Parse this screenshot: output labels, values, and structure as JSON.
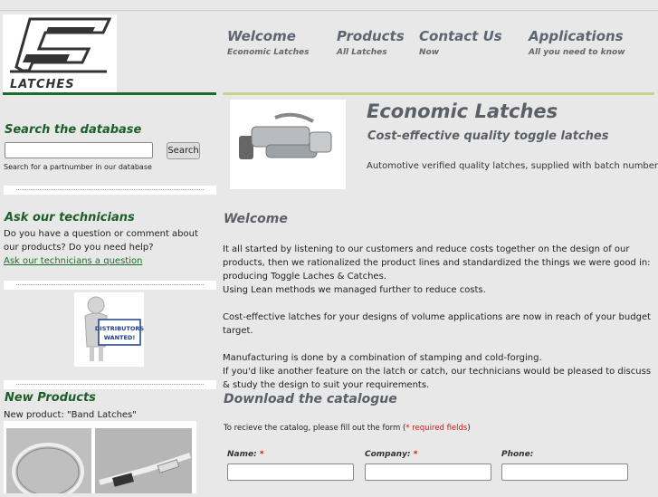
{
  "logo": {
    "word": "LATCHES"
  },
  "nav": [
    {
      "title": "Welcome",
      "sub": "Economic Latches"
    },
    {
      "title": "Products",
      "sub": "All Latches"
    },
    {
      "title": "Contact Us",
      "sub": "Now"
    },
    {
      "title": "Applications",
      "sub": "All you need to know"
    }
  ],
  "sidebar": {
    "search": {
      "heading": "Search the database",
      "button": "Search",
      "hint": "Search for a partnumber in our database"
    },
    "ask": {
      "heading": "Ask our technicians",
      "text": "Do you have a question or comment about our products? Do you need help?",
      "link": "Ask our technicians a question"
    },
    "distributors": {
      "line1": "DISTRIBUTORS",
      "line2": "WANTED!"
    },
    "new_products": {
      "heading": "New Products",
      "text": "New product: \"Band Latches\""
    }
  },
  "main": {
    "title": "Economic Latches",
    "subtitle": "Cost-effective quality toggle latches",
    "description": "Automotive verified quality latches, supplied with batch numbers.",
    "welcome": {
      "heading": "Welcome",
      "p1": "It all started by listening to our customers and reduce costs together on the design of our products, then we rationalized the product lines and standardized the things we were good in:",
      "p2": "producing Toggle Laches & Catches.",
      "p3": "Using Lean methods we managed further to reduce costs.",
      "p4": "Cost-effective latches for your designs of volume applications are now in reach of your budget target.",
      "p5": "Manufacturing is done by a combination of stamping and cold-forging.",
      "p6": "If you'd like another feature on the latch or catch, our technicians would be pleased to discuss & study the design to suit your requirements."
    },
    "catalogue": {
      "heading": "Download the catalogue",
      "note": "To recieve the catalog, please fill out the form (",
      "note_req": "* required fields",
      "note_end": ")",
      "fields": [
        {
          "label": "Name:",
          "required": "*"
        },
        {
          "label": "Company:",
          "required": "*"
        },
        {
          "label": "Phone:",
          "required": ""
        }
      ]
    }
  }
}
